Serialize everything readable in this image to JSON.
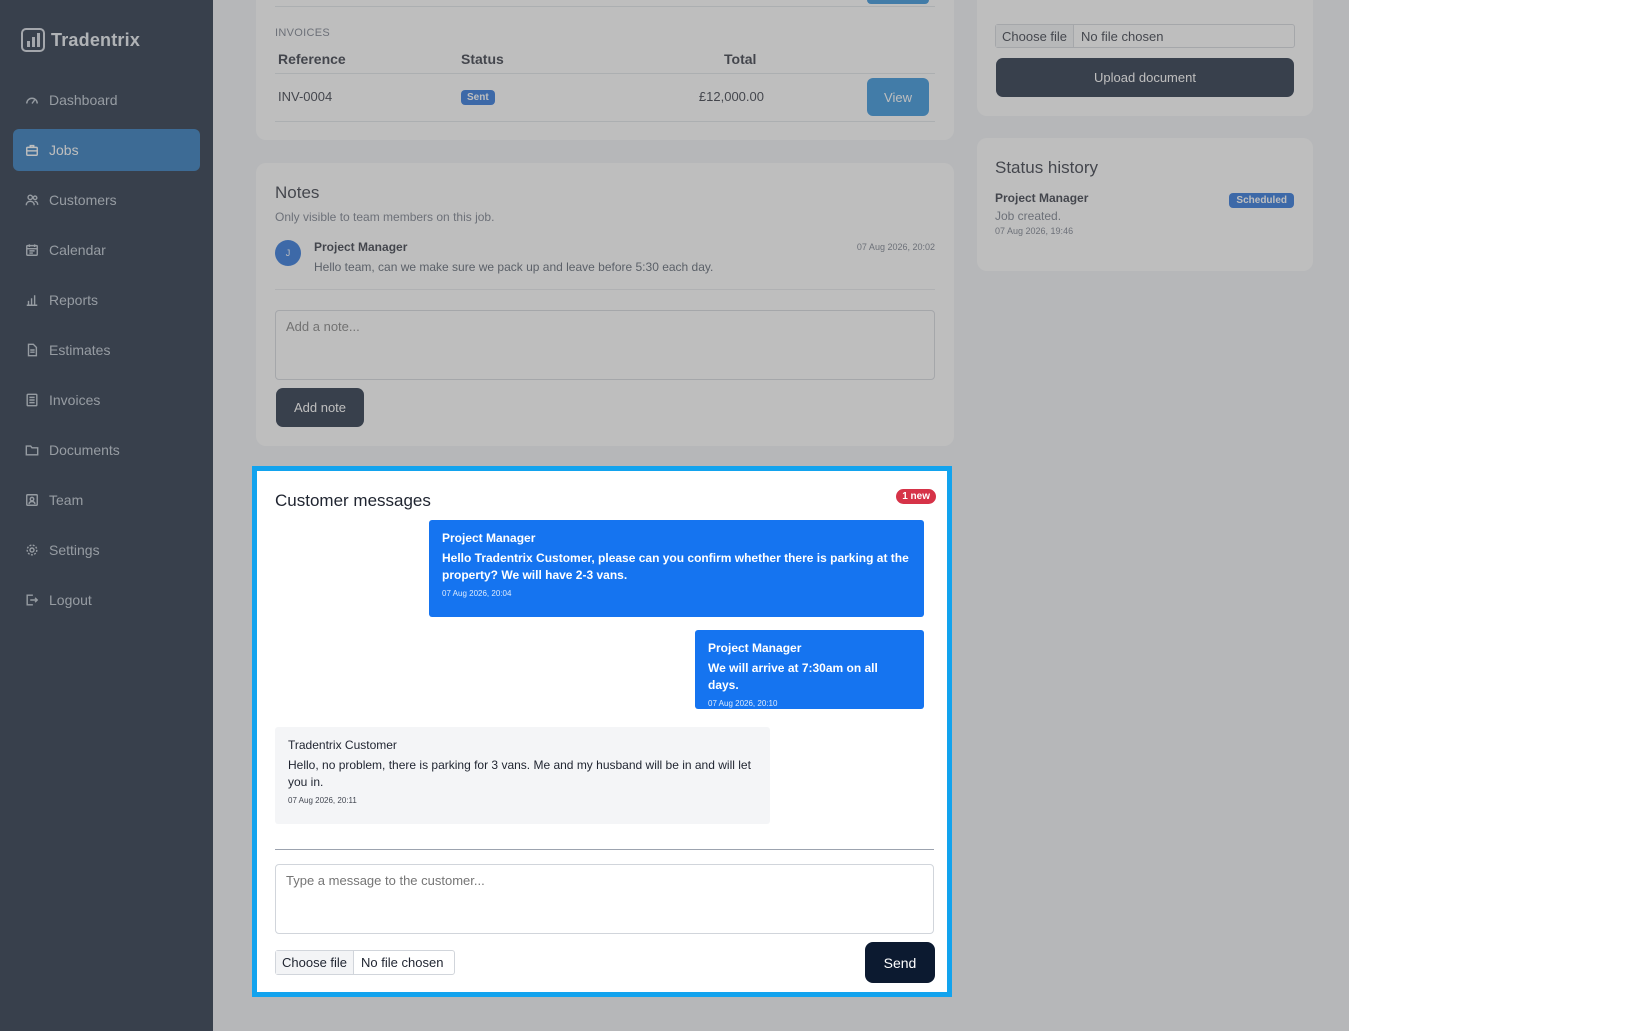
{
  "brand": {
    "name": "Tradentrix",
    "logo_icon": "bar-chart-logo"
  },
  "sidebar": {
    "items": [
      {
        "label": "Dashboard",
        "icon": "gauge-icon",
        "active": false
      },
      {
        "label": "Jobs",
        "icon": "briefcase-icon",
        "active": true
      },
      {
        "label": "Customers",
        "icon": "users-icon",
        "active": false
      },
      {
        "label": "Calendar",
        "icon": "calendar-icon",
        "active": false
      },
      {
        "label": "Reports",
        "icon": "bar-chart-icon",
        "active": false
      },
      {
        "label": "Estimates",
        "icon": "file-icon",
        "active": false
      },
      {
        "label": "Invoices",
        "icon": "list-icon",
        "active": false
      },
      {
        "label": "Documents",
        "icon": "folder-icon",
        "active": false
      },
      {
        "label": "Team",
        "icon": "id-badge-icon",
        "active": false
      },
      {
        "label": "Settings",
        "icon": "gear-icon",
        "active": false
      },
      {
        "label": "Logout",
        "icon": "logout-icon",
        "active": false
      }
    ]
  },
  "invoices": {
    "section_label": "INVOICES",
    "columns": [
      "Reference",
      "Status",
      "Total"
    ],
    "rows": [
      {
        "reference": "INV-0004",
        "status": "Sent",
        "total": "£12,000.00",
        "action": "View"
      }
    ]
  },
  "notes": {
    "title": "Notes",
    "subtitle": "Only visible to team members on this job.",
    "items": [
      {
        "avatar": "J",
        "author": "Project Manager",
        "time": "07 Aug 2026, 20:02",
        "text": "Hello team, can we make sure we pack up and leave before 5:30 each day."
      }
    ],
    "input_placeholder": "Add a note...",
    "add_button": "Add note"
  },
  "documents": {
    "file_button": "Choose file",
    "file_status": "No file chosen",
    "upload_button": "Upload document"
  },
  "status_history": {
    "title": "Status history",
    "items": [
      {
        "who": "Project Manager",
        "what": "Job created.",
        "when": "07 Aug 2026, 19:46",
        "badge": "Scheduled"
      }
    ]
  },
  "messages": {
    "title": "Customer messages",
    "new_badge": "1 new",
    "items": [
      {
        "direction": "out",
        "author": "Project Manager",
        "text": "Hello Tradentrix Customer, please can you confirm whether there is parking at the property? We will have 2-3 vans.",
        "time": "07 Aug 2026, 20:04"
      },
      {
        "direction": "out",
        "author": "Project Manager",
        "text": "We will arrive at 7:30am on all days.",
        "time": "07 Aug 2026, 20:10"
      },
      {
        "direction": "in",
        "author": "Tradentrix Customer",
        "text": "Hello, no problem, there is parking for 3 vans. Me and my husband will be in and will let you in.",
        "time": "07 Aug 2026, 20:11"
      }
    ],
    "input_placeholder": "Type a message to the customer...",
    "file_button": "Choose file",
    "file_status": "No file chosen",
    "send_button": "Send"
  },
  "colors": {
    "sidebar_bg": "#0c1a30",
    "active_nav": "#1469b4",
    "message_out": "#1574f0",
    "highlight_border": "#12a3ee",
    "badge_new": "#d63348",
    "badge_blue": "#1565d8"
  }
}
